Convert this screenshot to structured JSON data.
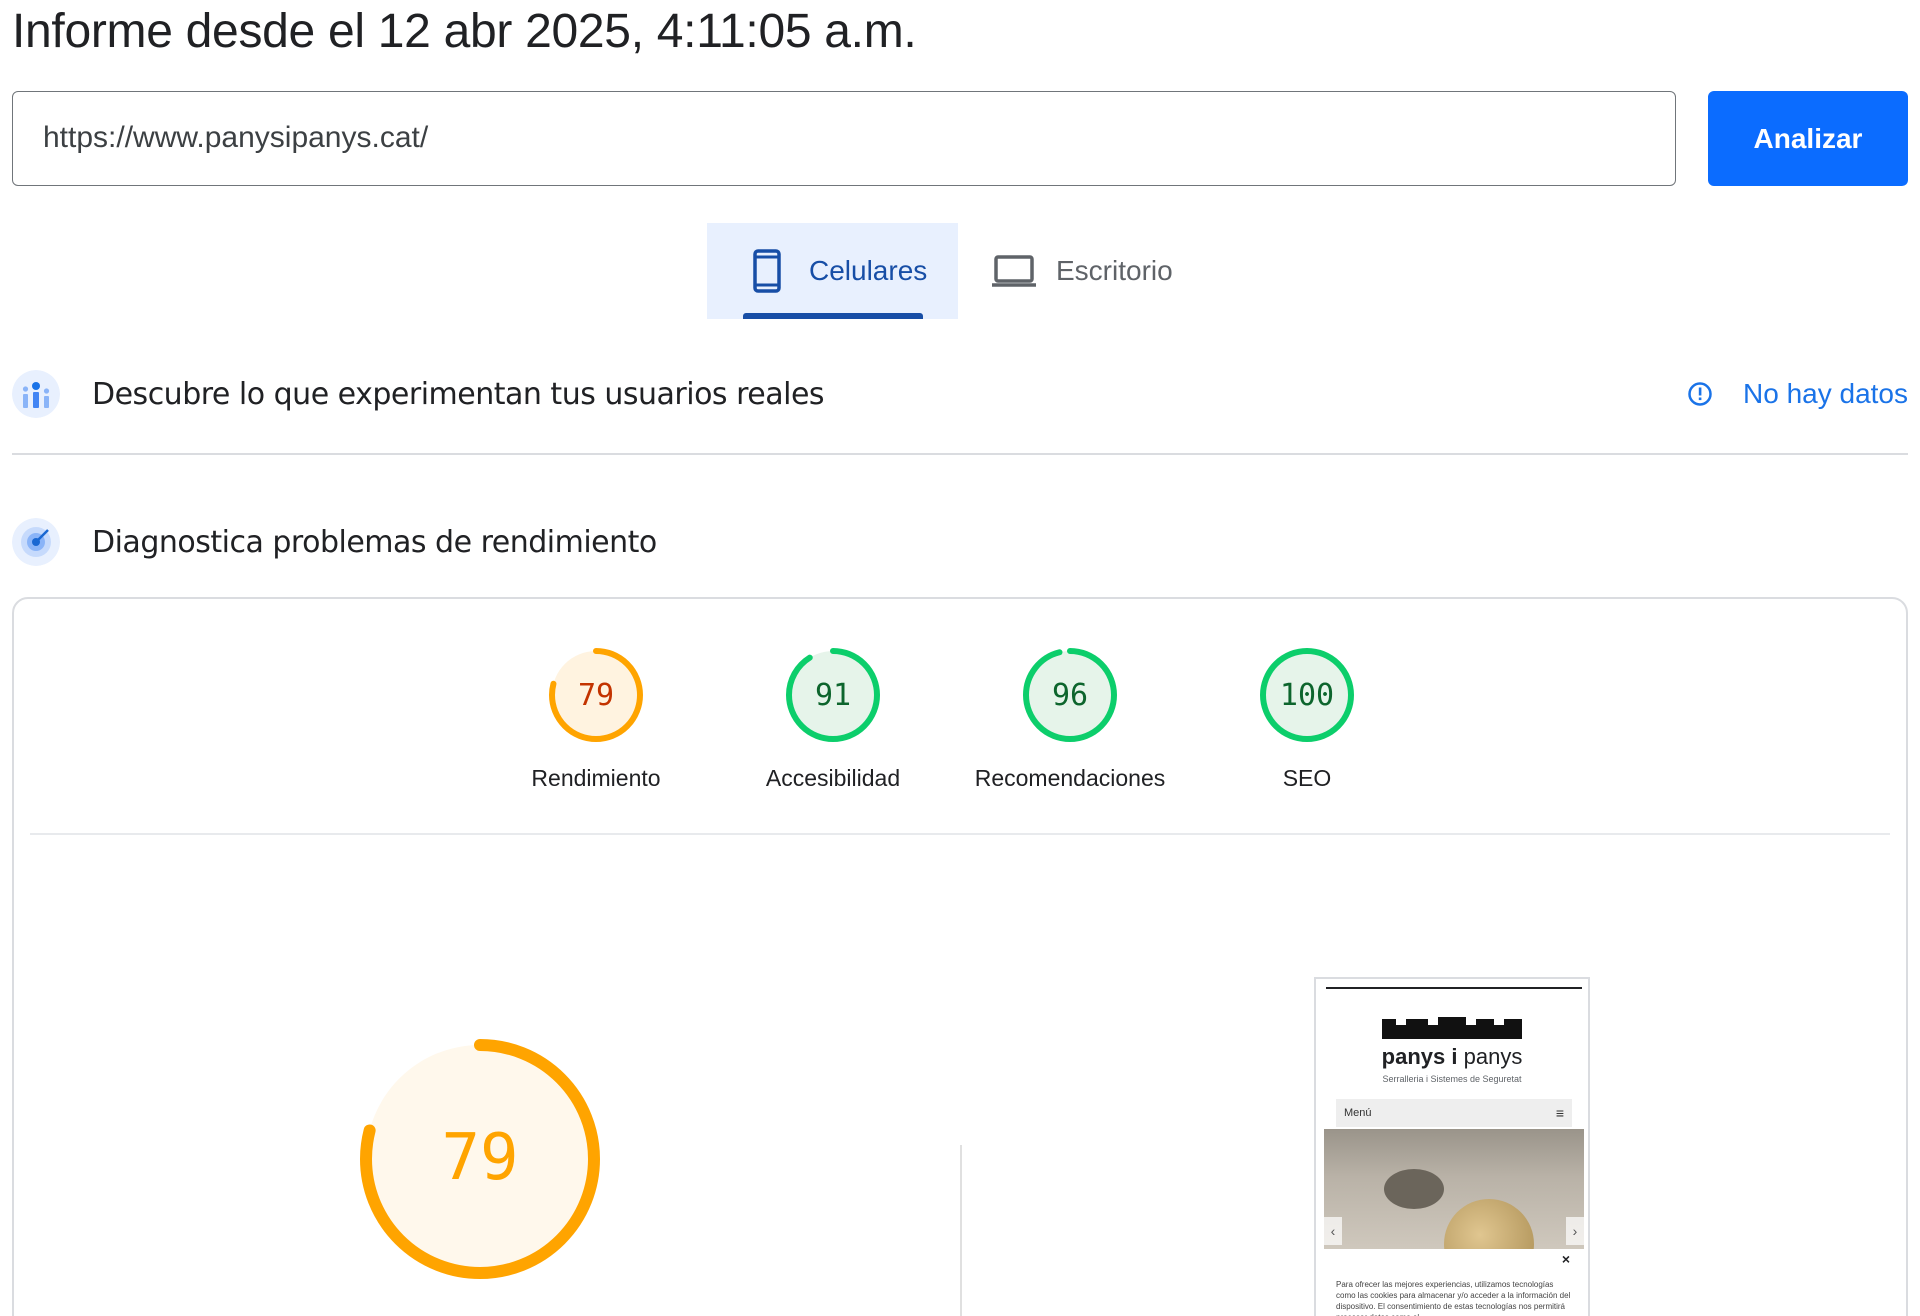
{
  "report": {
    "title": "Informe desde el 12 abr 2025, 4:11:05 a.m."
  },
  "search": {
    "url_value": "https://www.panysipanys.cat/",
    "analyze_label": "Analizar"
  },
  "tabs": [
    {
      "label": "Celulares",
      "icon": "smartphone-icon",
      "active": true
    },
    {
      "label": "Escritorio",
      "icon": "laptop-icon",
      "active": false
    }
  ],
  "field_data": {
    "title": "Descubre lo que experimentan tus usuarios reales",
    "status": "No hay datos",
    "icon": "users-chart-icon"
  },
  "lab_data": {
    "title": "Diagnostica problemas de rendimiento",
    "icon": "target-icon"
  },
  "scores": [
    {
      "label": "Rendimiento",
      "value": 79,
      "color": "#ffa400",
      "text_color": "#c33300",
      "bg": "#fff3e0"
    },
    {
      "label": "Accesibilidad",
      "value": 91,
      "color": "#0cce6b",
      "text_color": "#0d652d",
      "bg": "#e6f4ea"
    },
    {
      "label": "Recomendaciones",
      "value": 96,
      "color": "#0cce6b",
      "text_color": "#0d652d",
      "bg": "#e6f4ea"
    },
    {
      "label": "SEO",
      "value": 100,
      "color": "#0cce6b",
      "text_color": "#0d652d",
      "bg": "#e6f4ea"
    }
  ],
  "big_score": {
    "value": 79,
    "color": "#ffa400",
    "text_color": "#ffa400",
    "bg": "#fff8ec"
  },
  "preview": {
    "logo_bold": "panys",
    "logo_i": "i",
    "logo_regular": "panys",
    "tagline": "Serralleria i Sistemes de Seguretat",
    "menu_label": "Menú",
    "menu_icon": "≡",
    "close_icon": "×",
    "prev_arrow": "‹",
    "next_arrow": "›",
    "cookie_text": "Para ofrecer las mejores experiencias, utilizamos tecnologías como las cookies para almacenar y/o acceder a la información del dispositivo. El consentimiento de estas tecnologías nos permitirá procesar datos como el"
  }
}
